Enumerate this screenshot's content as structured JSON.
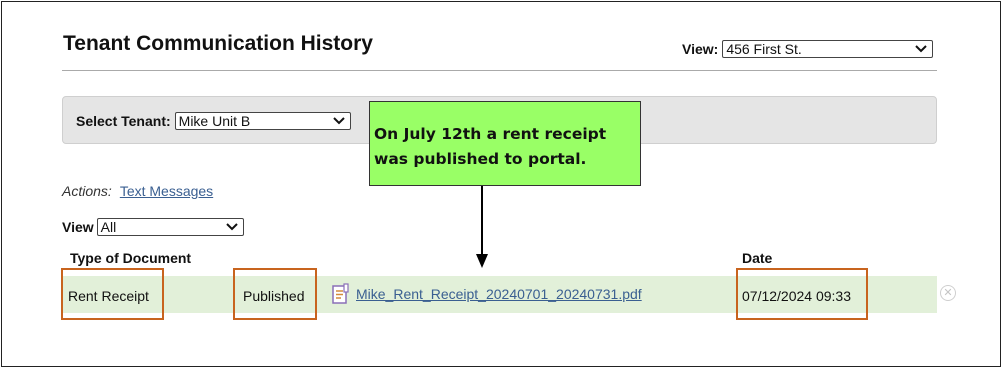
{
  "page": {
    "title": "Tenant Communication History"
  },
  "property_view": {
    "label": "View:",
    "selected": "456 First St."
  },
  "tenant_select": {
    "label": "Select Tenant:",
    "selected": "Mike Unit B"
  },
  "annotation": {
    "text": "On July 12th a rent receipt was published to portal.",
    "color": "#99ff66"
  },
  "actions": {
    "label": "Actions:",
    "text_messages_link": "Text Messages"
  },
  "view_filter": {
    "label": "View",
    "selected": "All"
  },
  "table": {
    "headers": {
      "type": "Type of Document",
      "date": "Date"
    },
    "rows": [
      {
        "type": "Rent Receipt",
        "status": "Published",
        "file": "Mike_Rent_Receipt_20240701_20240731.pdf",
        "file_icon": "document-icon",
        "date": "07/12/2024 09:33",
        "remove_icon": "close-circle-icon"
      }
    ]
  },
  "colors": {
    "highlight_box": "#c8641e",
    "row_background": "#e2f0d9",
    "link": "#3a5f91"
  }
}
